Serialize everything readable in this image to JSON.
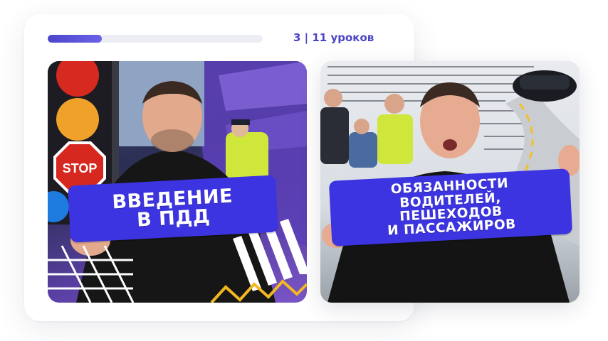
{
  "progress": {
    "counter_text": "3 | 11 уроков",
    "completed_lessons": 3,
    "total_lessons": 11,
    "fill_fraction": 0.25,
    "accent_color": "#4c46cc"
  },
  "lessons": [
    {
      "title_lines": [
        "Введение",
        "в ПДД"
      ],
      "sign_text": "STOP",
      "banner_color": "#3c34e0"
    },
    {
      "title_lines": [
        "Обязанности",
        "водителей,",
        "пешеходов",
        "и пассажиров"
      ],
      "banner_color": "#3c34e0"
    }
  ]
}
